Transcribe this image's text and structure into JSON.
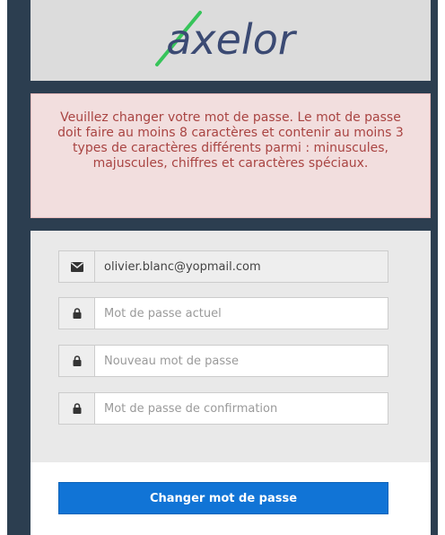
{
  "logo": {
    "text": "axelor"
  },
  "alert": {
    "message": "Veuillez changer votre mot de passe. Le mot de passe doit faire au moins 8 caractères et contenir au moins 3 types de caractères différents parmi : minuscules, majuscules, chiffres et caractères spéciaux."
  },
  "form": {
    "email": {
      "value": "olivier.blanc@yopmail.com",
      "icon": "envelope-icon"
    },
    "current_password": {
      "placeholder": "Mot de passe actuel",
      "icon": "lock-icon"
    },
    "new_password": {
      "placeholder": "Nouveau mot de passe",
      "icon": "lock-icon"
    },
    "confirm_password": {
      "placeholder": "Mot de passe de confirmation",
      "icon": "lock-icon"
    }
  },
  "submit": {
    "label": "Changer mot de passe"
  },
  "colors": {
    "frame": "#2c3e50",
    "alert_bg": "#f2dede",
    "alert_text": "#a94442",
    "primary": "#1174d6",
    "logo_text": "#3b4a73",
    "logo_x": "#37c45a"
  }
}
